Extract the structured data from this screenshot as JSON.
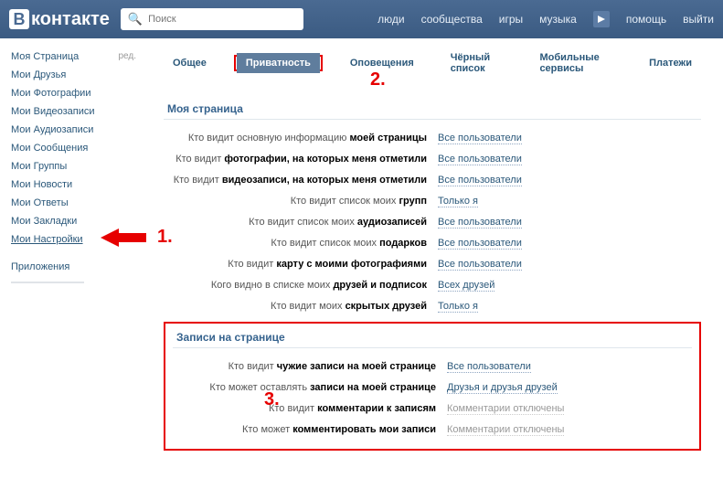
{
  "header": {
    "logo_text": "контакте",
    "search_placeholder": "Поиск",
    "nav": {
      "people": "люди",
      "communities": "сообщества",
      "games": "игры",
      "music": "музыка",
      "help": "помощь",
      "logout": "выйти"
    }
  },
  "sidebar": {
    "items": [
      "Моя Страница",
      "Мои Друзья",
      "Мои Фотографии",
      "Мои Видеозаписи",
      "Мои Аудиозаписи",
      "Мои Сообщения",
      "Мои Группы",
      "Мои Новости",
      "Мои Ответы",
      "Мои Закладки",
      "Мои Настройки"
    ],
    "edit": "ред.",
    "apps": "Приложения"
  },
  "tabs": {
    "general": "Общее",
    "privacy": "Приватность",
    "notifications": "Оповещения",
    "blacklist": "Чёрный список",
    "mobile": "Мобильные сервисы",
    "payments": "Платежи"
  },
  "annotations": {
    "one": "1.",
    "two": "2.",
    "three": "3."
  },
  "section1": {
    "title": "Моя страница",
    "rows": [
      {
        "pre": "Кто видит основную информацию ",
        "bold": "моей страницы",
        "val": "Все пользователи"
      },
      {
        "pre": "Кто видит ",
        "bold": "фотографии, на которых меня отметили",
        "val": "Все пользователи"
      },
      {
        "pre": "Кто видит ",
        "bold": "видеозаписи, на которых меня отметили",
        "val": "Все пользователи"
      },
      {
        "pre": "Кто видит список моих ",
        "bold": "групп",
        "val": "Только я"
      },
      {
        "pre": "Кто видит список моих ",
        "bold": "аудиозаписей",
        "val": "Все пользователи"
      },
      {
        "pre": "Кто видит список моих ",
        "bold": "подарков",
        "val": "Все пользователи"
      },
      {
        "pre": "Кто видит ",
        "bold": "карту с моими фотографиями",
        "val": "Все пользователи"
      },
      {
        "pre": "Кого видно в списке моих ",
        "bold": "друзей и подписок",
        "val": "Всех друзей"
      },
      {
        "pre": "Кто видит моих ",
        "bold": "скрытых друзей",
        "val": "Только я"
      }
    ]
  },
  "section2": {
    "title": "Записи на странице",
    "rows": [
      {
        "pre": "Кто видит ",
        "bold": "чужие записи на моей странице",
        "val": "Все пользователи",
        "disabled": false
      },
      {
        "pre": "Кто может оставлять ",
        "bold": "записи на моей странице",
        "val": "Друзья и друзья друзей",
        "disabled": false
      },
      {
        "pre": "Кто видит ",
        "bold": "комментарии к записям",
        "val": "Комментарии отключены",
        "disabled": true
      },
      {
        "pre": "Кто может ",
        "bold": "комментировать мои записи",
        "val": "Комментарии отключены",
        "disabled": true
      }
    ]
  }
}
